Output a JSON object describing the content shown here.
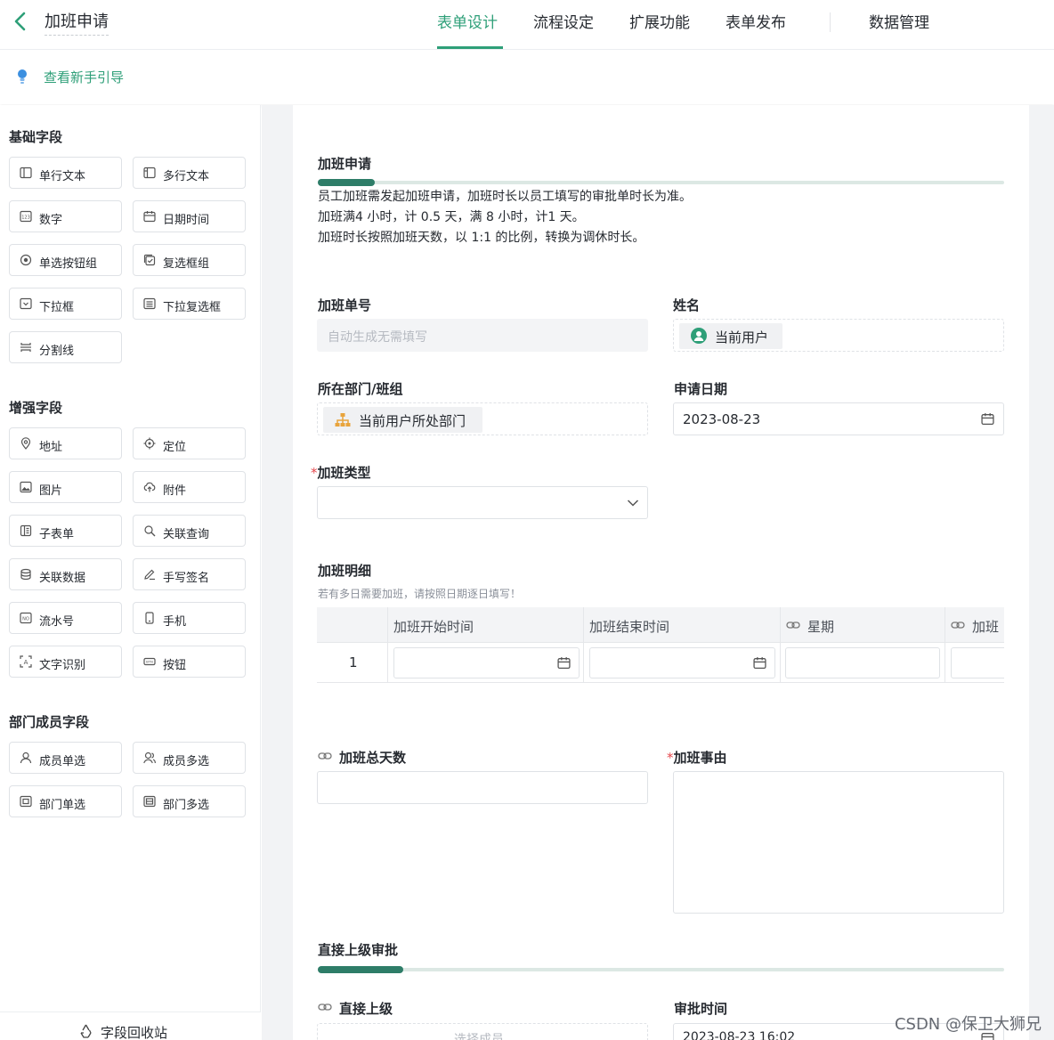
{
  "header": {
    "title": "加班申请",
    "tabs": [
      {
        "label": "表单设计",
        "active": true
      },
      {
        "label": "流程设定",
        "active": false
      },
      {
        "label": "扩展功能",
        "active": false
      },
      {
        "label": "表单发布",
        "active": false
      },
      {
        "label": "数据管理",
        "active": false
      }
    ]
  },
  "guide": {
    "label": "查看新手引导"
  },
  "sidebar": {
    "sections": [
      {
        "title": "基础字段",
        "items": [
          {
            "label": "单行文本",
            "icon": "single-line-text-icon"
          },
          {
            "label": "多行文本",
            "icon": "multi-line-text-icon"
          },
          {
            "label": "数字",
            "icon": "number-icon"
          },
          {
            "label": "日期时间",
            "icon": "calendar-icon"
          },
          {
            "label": "单选按钮组",
            "icon": "radio-icon"
          },
          {
            "label": "复选框组",
            "icon": "checkbox-icon"
          },
          {
            "label": "下拉框",
            "icon": "dropdown-icon"
          },
          {
            "label": "下拉复选框",
            "icon": "dropdown-multi-icon"
          },
          {
            "label": "分割线",
            "icon": "divider-icon"
          }
        ]
      },
      {
        "title": "增强字段",
        "items": [
          {
            "label": "地址",
            "icon": "location-pin-icon"
          },
          {
            "label": "定位",
            "icon": "locate-icon"
          },
          {
            "label": "图片",
            "icon": "image-icon"
          },
          {
            "label": "附件",
            "icon": "upload-cloud-icon"
          },
          {
            "label": "子表单",
            "icon": "subform-icon"
          },
          {
            "label": "关联查询",
            "icon": "related-query-icon"
          },
          {
            "label": "关联数据",
            "icon": "related-data-icon"
          },
          {
            "label": "手写签名",
            "icon": "pen-icon"
          },
          {
            "label": "流水号",
            "icon": "serial-number-icon"
          },
          {
            "label": "手机",
            "icon": "phone-icon"
          },
          {
            "label": "文字识别",
            "icon": "ocr-icon"
          },
          {
            "label": "按钮",
            "icon": "button-icon"
          }
        ]
      },
      {
        "title": "部门成员字段",
        "items": [
          {
            "label": "成员单选",
            "icon": "user-icon"
          },
          {
            "label": "成员多选",
            "icon": "users-icon"
          },
          {
            "label": "部门单选",
            "icon": "department-icon"
          },
          {
            "label": "部门多选",
            "icon": "departments-icon"
          }
        ]
      }
    ],
    "recycle_label": "字段回收站"
  },
  "form": {
    "section1_title": "加班申请",
    "description": [
      "员工加班需发起加班申请，加班时长以员工填写的审批单时长为准。",
      "加班满4 小时，计 0.5 天，满 8 小时，计1 天。",
      "加班时长按照加班天数，以 1:1 的比例，转换为调休时长。"
    ],
    "order_no": {
      "label": "加班单号",
      "placeholder": "自动生成无需填写"
    },
    "name": {
      "label": "姓名",
      "value": "当前用户"
    },
    "department": {
      "label": "所在部门/班组",
      "value": "当前用户所处部门"
    },
    "apply_date": {
      "label": "申请日期",
      "value": "2023-08-23"
    },
    "overtime_type": {
      "required_mark": "*",
      "label": "加班类型"
    },
    "details": {
      "label": "加班明细",
      "hint": "若有多日需要加班，请按照日期逐日填写！",
      "columns": [
        "加班开始时间",
        "加班结束时间",
        "星期",
        "加班"
      ],
      "row_index": "1"
    },
    "total_days": {
      "label": "加班总天数"
    },
    "reason": {
      "required_mark": "*",
      "label": "加班事由"
    },
    "section2_title": "直接上级审批",
    "supervisor": {
      "label": "直接上级",
      "placeholder": "选择成员"
    },
    "approve_time": {
      "label": "审批时间",
      "value": "2023-08-23 16:02"
    }
  },
  "watermark": "CSDN @保卫大狮兄",
  "colors": {
    "accent": "#2e9f78",
    "bar": "#2e7d68",
    "required": "#e5484d"
  }
}
